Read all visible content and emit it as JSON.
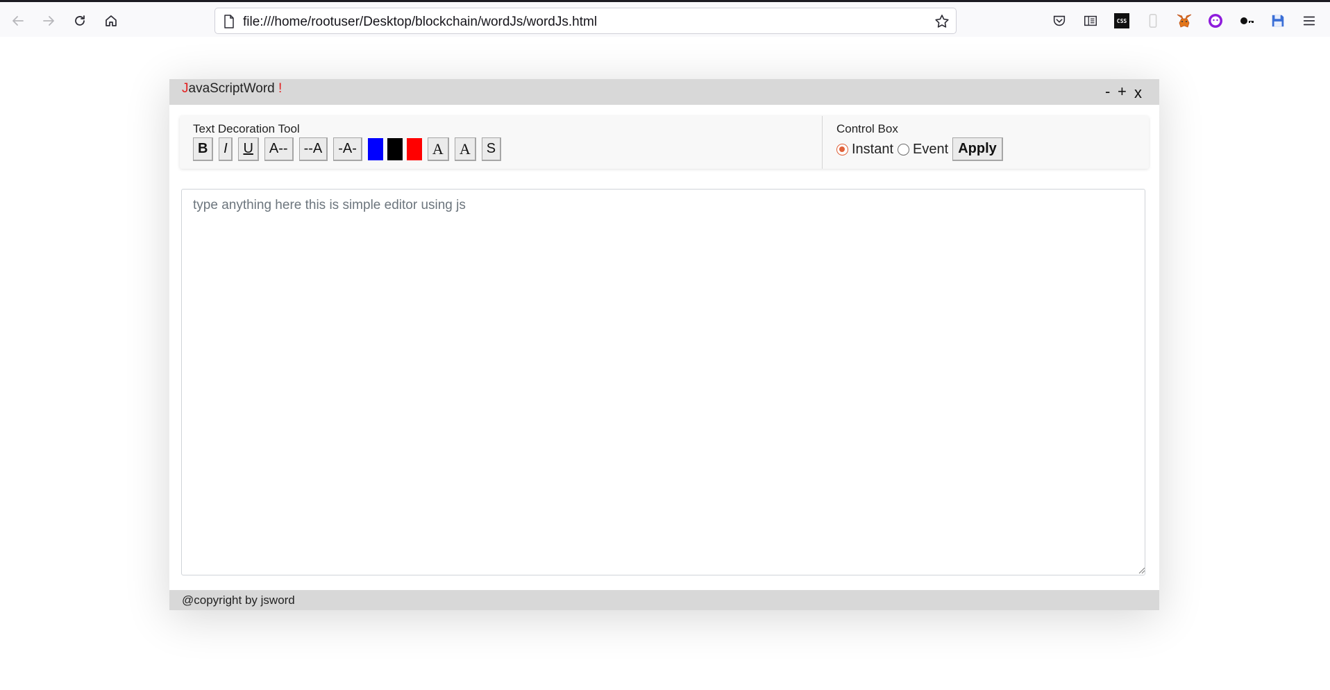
{
  "browser": {
    "url": "file:///home/rootuser/Desktop/blockchain/wordJs/wordJs.html",
    "toolbar_icons": [
      "back-icon",
      "forward-icon",
      "reload-icon",
      "home-icon",
      "page-icon",
      "bookmark-star-icon",
      "pocket-icon",
      "reader-view-icon",
      "css-extension-icon",
      "device-icon",
      "metamask-fox-icon",
      "extension-face-icon",
      "key-icon",
      "save-icon",
      "hamburger-menu-icon"
    ],
    "css_badge": "CSS"
  },
  "app": {
    "title_first": "J",
    "title_rest": "avaScriptWord",
    "title_bang": "!",
    "window_controls": {
      "minimize": "-",
      "maximize": "+",
      "close": "x"
    },
    "colors": {
      "accent": "#e21d1d",
      "bar": "#d8d8d8",
      "radio": "#e0623a"
    }
  },
  "tools": {
    "label": "Text Decoration Tool",
    "bold": "B",
    "italic": "I",
    "underline": "U",
    "size_decrease": "A--",
    "size_increase": "--A",
    "size_reset": "-A-",
    "colors": [
      {
        "name": "blue",
        "value": "#0000ff"
      },
      {
        "name": "black",
        "value": "#000000"
      },
      {
        "name": "red",
        "value": "#ff0000"
      }
    ],
    "font_a1": "A",
    "font_a2": "A",
    "strike": "S"
  },
  "control_box": {
    "label": "Control Box",
    "options": [
      "Instant",
      "Event"
    ],
    "selected": "Instant",
    "apply_label": "Apply"
  },
  "editor": {
    "placeholder": "type anything here this is simple editor using js",
    "value": ""
  },
  "footer": {
    "text": "@copyright by jsword"
  }
}
